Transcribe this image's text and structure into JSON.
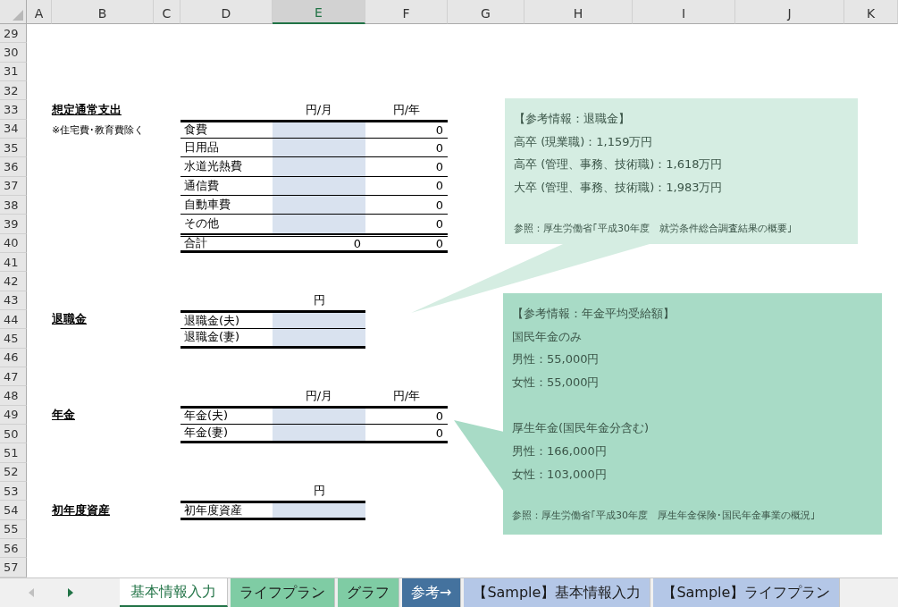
{
  "columns": [
    {
      "label": "A",
      "selected": false
    },
    {
      "label": "B",
      "selected": false
    },
    {
      "label": "C",
      "selected": false
    },
    {
      "label": "D",
      "selected": false
    },
    {
      "label": "E",
      "selected": true
    },
    {
      "label": "F",
      "selected": false
    },
    {
      "label": "G",
      "selected": false
    },
    {
      "label": "H",
      "selected": false
    },
    {
      "label": "I",
      "selected": false
    },
    {
      "label": "J",
      "selected": false
    },
    {
      "label": "K",
      "selected": false
    }
  ],
  "rows": [
    "29",
    "30",
    "31",
    "32",
    "33",
    "34",
    "35",
    "36",
    "37",
    "38",
    "39",
    "40",
    "41",
    "42",
    "43",
    "44",
    "45",
    "46",
    "47",
    "48",
    "49",
    "50",
    "51",
    "52",
    "53",
    "54",
    "55",
    "56",
    "57"
  ],
  "sections": [
    {
      "title": "想定通常支出",
      "note": "※住宅費･教育費除く",
      "headers": [
        "円/月",
        "円/年"
      ],
      "rows": [
        {
          "kind": "input",
          "label": "食費",
          "yearly": "0"
        },
        {
          "kind": "input",
          "label": "日用品",
          "yearly": "0"
        },
        {
          "kind": "input",
          "label": "水道光熱費",
          "yearly": "0"
        },
        {
          "kind": "input",
          "label": "通信費",
          "yearly": "0"
        },
        {
          "kind": "input",
          "label": "自動車費",
          "yearly": "0"
        },
        {
          "kind": "input",
          "label": "その他",
          "yearly": "0"
        },
        {
          "kind": "total",
          "label": "合計",
          "monthly": "0",
          "yearly": "0"
        }
      ]
    },
    {
      "title": "退職金",
      "headers": [
        "円"
      ],
      "rows": [
        {
          "kind": "input",
          "label": "退職金(夫)"
        },
        {
          "kind": "input",
          "label": "退職金(妻)"
        }
      ]
    },
    {
      "title": "年金",
      "headers": [
        "円/月",
        "円/年"
      ],
      "rows": [
        {
          "kind": "input",
          "label": "年金(夫)",
          "yearly": "0"
        },
        {
          "kind": "input",
          "label": "年金(妻)",
          "yearly": "0"
        }
      ]
    },
    {
      "title": "初年度資産",
      "headers": [
        "円"
      ],
      "rows": [
        {
          "kind": "input",
          "label": "初年度資産"
        }
      ]
    }
  ],
  "callouts": [
    {
      "color": "#d5ede2",
      "title": "【参考情報：退職金】",
      "groups": [
        [
          "高卒 (現業職)：1,159万円",
          "高卒 (管理、事務、技術職)：1,618万円",
          "大卒 (管理、事務、技術職)：1,983万円"
        ]
      ],
      "source": "参照：厚生労働省｢平成30年度　就労条件総合調査結果の概要｣"
    },
    {
      "color": "#a8dbc6",
      "title": "【参考情報：年金平均受給額】",
      "groups": [
        [
          "国民年金のみ",
          "男性：55,000円",
          "女性：55,000円"
        ],
        [
          "厚生年金(国民年金分含む)",
          "男性：166,000円",
          "女性：103,000円"
        ]
      ],
      "source": "参照：厚生労働省｢平成30年度　厚生年金保険･国民年金事業の概況｣"
    }
  ],
  "tabs": [
    {
      "label": "基本情報入力",
      "selected": true,
      "color": "#ffffff"
    },
    {
      "label": "ライフプラン",
      "selected": false,
      "color": "#7fcca4"
    },
    {
      "label": "グラフ",
      "selected": false,
      "color": "#7fcca4"
    },
    {
      "label": "参考→",
      "selected": false,
      "color": "#44729e"
    },
    {
      "label": "【Sample】基本情報入力",
      "selected": false,
      "color": "#b4c7e7"
    },
    {
      "label": "【Sample】ライフプラン",
      "selected": false,
      "color": "#b4c7e7"
    }
  ]
}
